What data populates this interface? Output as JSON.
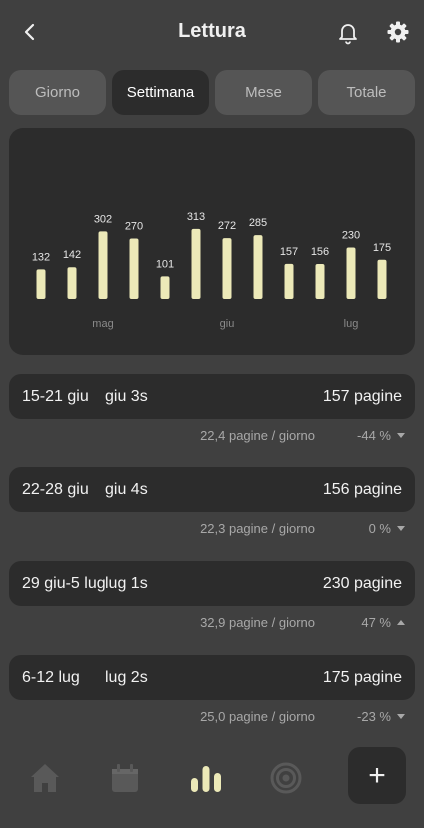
{
  "header": {
    "title": "Lettura",
    "icons": [
      "chevron-left",
      "bell",
      "gear"
    ]
  },
  "tabs": [
    {
      "label": "Giorno",
      "active": false
    },
    {
      "label": "Settimana",
      "active": true
    },
    {
      "label": "Mese",
      "active": false
    },
    {
      "label": "Totale",
      "active": false
    }
  ],
  "chart_data": {
    "type": "bar",
    "values": [
      132,
      142,
      302,
      270,
      101,
      313,
      272,
      285,
      157,
      156,
      230,
      175
    ],
    "month_labels": [
      {
        "label": "mag",
        "at": 2
      },
      {
        "label": "giu",
        "at": 6
      },
      {
        "label": "lug",
        "at": 10
      }
    ],
    "bar_color": "#ece9b8"
  },
  "weeks": [
    {
      "range": "15-21 giu",
      "code": "giu 3s",
      "pages": "157 pagine",
      "rate": "22,4 pagine / giorno",
      "change": "-44 %",
      "direction": "down"
    },
    {
      "range": "22-28 giu",
      "code": "giu 4s",
      "pages": "156 pagine",
      "rate": "22,3 pagine / giorno",
      "change": "0 %",
      "direction": "down"
    },
    {
      "range": "29 giu-5 lug",
      "code": "lug 1s",
      "pages": "230 pagine",
      "rate": "32,9 pagine / giorno",
      "change": "47 %",
      "direction": "up"
    },
    {
      "range": "6-12 lug",
      "code": "lug 2s",
      "pages": "175 pagine",
      "rate": "25,0 pagine / giorno",
      "change": "-23 %",
      "direction": "down"
    }
  ],
  "nav": {
    "items": [
      "home",
      "calendar",
      "stats",
      "target"
    ],
    "active": "stats",
    "add_label": "+"
  }
}
